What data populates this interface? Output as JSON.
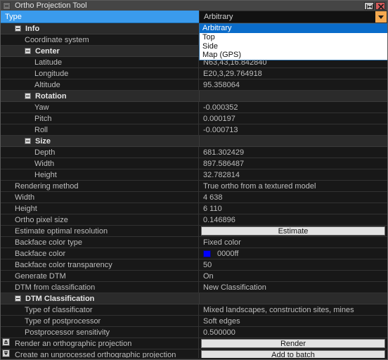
{
  "window": {
    "title": "Ortho Projection Tool",
    "collapse_icon": "minimize-icon",
    "dock_icon": "undock-icon",
    "close_icon": "close-icon"
  },
  "type_row": {
    "label": "Type",
    "value": "Arbitrary",
    "arrow_icon": "chevron-down-icon"
  },
  "dropdown": {
    "open": true,
    "options": [
      "Arbitrary",
      "Top",
      "Side",
      "Map (GPS)"
    ],
    "selected": "Arbitrary"
  },
  "colors": {
    "accent_blue": "#3a9bed",
    "dropdown_arrow": "#f5a94f",
    "backface_swatch": "#0000ff",
    "titlebar": "#454545",
    "close_button": "#d45b5b"
  },
  "rows": [
    {
      "kind": "group",
      "indent": 1,
      "expander": true,
      "name": "Info",
      "value": ""
    },
    {
      "kind": "prop",
      "indent": 2,
      "expander": false,
      "name": "Coordinate system",
      "value": ""
    },
    {
      "kind": "group",
      "indent": 2,
      "expander": true,
      "name": "Center",
      "value": ""
    },
    {
      "kind": "prop",
      "indent": 3,
      "expander": false,
      "name": "Latitude",
      "value": "N63,43,16.842840"
    },
    {
      "kind": "prop",
      "indent": 3,
      "expander": false,
      "name": "Longitude",
      "value": "E20,3,29.764918"
    },
    {
      "kind": "prop",
      "indent": 3,
      "expander": false,
      "name": "Altitude",
      "value": "95.358064"
    },
    {
      "kind": "group",
      "indent": 2,
      "expander": true,
      "name": "Rotation",
      "value": ""
    },
    {
      "kind": "prop",
      "indent": 3,
      "expander": false,
      "name": "Yaw",
      "value": "-0.000352"
    },
    {
      "kind": "prop",
      "indent": 3,
      "expander": false,
      "name": "Pitch",
      "value": "0.000197"
    },
    {
      "kind": "prop",
      "indent": 3,
      "expander": false,
      "name": "Roll",
      "value": "-0.000713"
    },
    {
      "kind": "group",
      "indent": 2,
      "expander": true,
      "name": "Size",
      "value": ""
    },
    {
      "kind": "prop",
      "indent": 3,
      "expander": false,
      "name": "Depth",
      "value": "681.302429"
    },
    {
      "kind": "prop",
      "indent": 3,
      "expander": false,
      "name": "Width",
      "value": "897.586487"
    },
    {
      "kind": "prop",
      "indent": 3,
      "expander": false,
      "name": "Height",
      "value": "32.782814"
    },
    {
      "kind": "prop",
      "indent": 1,
      "expander": false,
      "name": "Rendering method",
      "value": "True ortho from a textured model"
    },
    {
      "kind": "prop",
      "indent": 1,
      "expander": false,
      "name": "Width",
      "value": "4 638"
    },
    {
      "kind": "prop",
      "indent": 1,
      "expander": false,
      "name": "Height",
      "value": "6 110"
    },
    {
      "kind": "prop",
      "indent": 1,
      "expander": false,
      "name": "Ortho pixel size",
      "value": "0.146896"
    },
    {
      "kind": "button",
      "indent": 1,
      "expander": false,
      "name": "Estimate optimal resolution",
      "value": "Estimate"
    },
    {
      "kind": "prop",
      "indent": 1,
      "expander": false,
      "name": "Backface color type",
      "value": "Fixed color"
    },
    {
      "kind": "color",
      "indent": 1,
      "expander": false,
      "name": "Backface color",
      "value": "0000ff"
    },
    {
      "kind": "prop",
      "indent": 1,
      "expander": false,
      "name": "Backface color transparency",
      "value": "50"
    },
    {
      "kind": "prop",
      "indent": 1,
      "expander": false,
      "name": "Generate DTM",
      "value": "On"
    },
    {
      "kind": "prop",
      "indent": 1,
      "expander": false,
      "name": "DTM from classification",
      "value": "New Classification"
    },
    {
      "kind": "group",
      "indent": 1,
      "expander": true,
      "name": "DTM Classification",
      "value": ""
    },
    {
      "kind": "prop",
      "indent": 2,
      "expander": false,
      "name": "Type of classificator",
      "value": "Mixed landscapes, construction sites, mines"
    },
    {
      "kind": "prop",
      "indent": 2,
      "expander": false,
      "name": "Type of postprocessor",
      "value": "Soft edges"
    },
    {
      "kind": "prop",
      "indent": 2,
      "expander": false,
      "name": "Postprocessor sensitivity",
      "value": "0.500000"
    },
    {
      "kind": "button",
      "indent": 1,
      "expander": false,
      "name": "Render an orthographic projection",
      "value": "Render"
    },
    {
      "kind": "button",
      "indent": 1,
      "expander": false,
      "name": "Create an unprocessed orthographic projection",
      "value": "Add to batch"
    }
  ],
  "gutter": {
    "scroll_up_icon": "scroll-up-icon",
    "scroll_down_icon": "scroll-down-icon"
  }
}
